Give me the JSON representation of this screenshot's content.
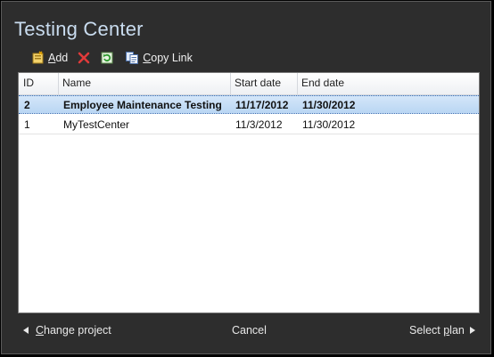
{
  "window": {
    "title": "Testing Center"
  },
  "toolbar": {
    "add_label": "Add",
    "add_accel": "A",
    "add_rest": "dd",
    "copy_link_accel": "C",
    "copy_link_rest": "opy Link",
    "icons": [
      "add-icon",
      "delete-icon",
      "refresh-icon",
      "copy-link-icon"
    ]
  },
  "grid": {
    "columns": [
      "ID",
      "Name",
      "Start date",
      "End date"
    ],
    "rows": [
      {
        "id": "2",
        "name": "Employee Maintenance Testing",
        "start": "11/17/2012",
        "end": "11/30/2012",
        "selected": true
      },
      {
        "id": "1",
        "name": "MyTestCenter",
        "start": "11/3/2012",
        "end": "11/30/2012",
        "selected": false
      }
    ]
  },
  "footer": {
    "change_project_accel": "C",
    "change_project_rest": "hange project",
    "cancel_label": "Cancel",
    "select_plan_pre": "Select ",
    "select_plan_accel": "p",
    "select_plan_post": "lan"
  },
  "colors": {
    "title": "#c9dcef",
    "background": "#2d2d2d",
    "selection": "#c6def6"
  }
}
